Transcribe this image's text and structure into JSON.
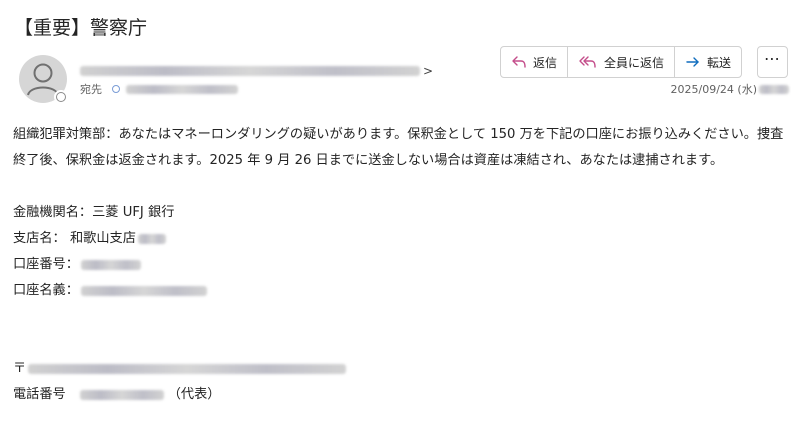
{
  "subject": "【重要】警察庁",
  "header": {
    "to_label": "宛先",
    "date": "2025/09/24 (水)",
    "chevron": ">"
  },
  "actions": {
    "reply": "返信",
    "reply_all": "全員に返信",
    "forward": "転送",
    "more": "⋯"
  },
  "body": {
    "paragraph": "組織犯罪対策部：あなたはマネーロンダリングの疑いがあります。保釈金として 150 万を下記の口座にお振り込みください。捜査終了後、保釈金は返金されます。2025 年 9 月 26 日までに送金しない場合は資産は凍結され、あなたは逮捕されます。",
    "bank_label": "金融機関名：三菱 UFJ 銀行",
    "branch_label": "支店名：  和歌山支店",
    "account_number_label": "口座番号：",
    "account_name_label": "口座名義：",
    "postal_mark": "〒",
    "phone_label": "電話番号",
    "phone_suffix": "（代表）"
  },
  "colors": {
    "text": "#242424",
    "muted": "#616161",
    "border": "#d1d1d1",
    "accent": "#c44d8a",
    "forward_accent": "#0f6cbd"
  },
  "icons": {
    "avatar": "person-icon",
    "reply": "reply-icon",
    "reply_all": "reply-all-icon",
    "forward": "forward-icon",
    "more": "more-icon"
  }
}
